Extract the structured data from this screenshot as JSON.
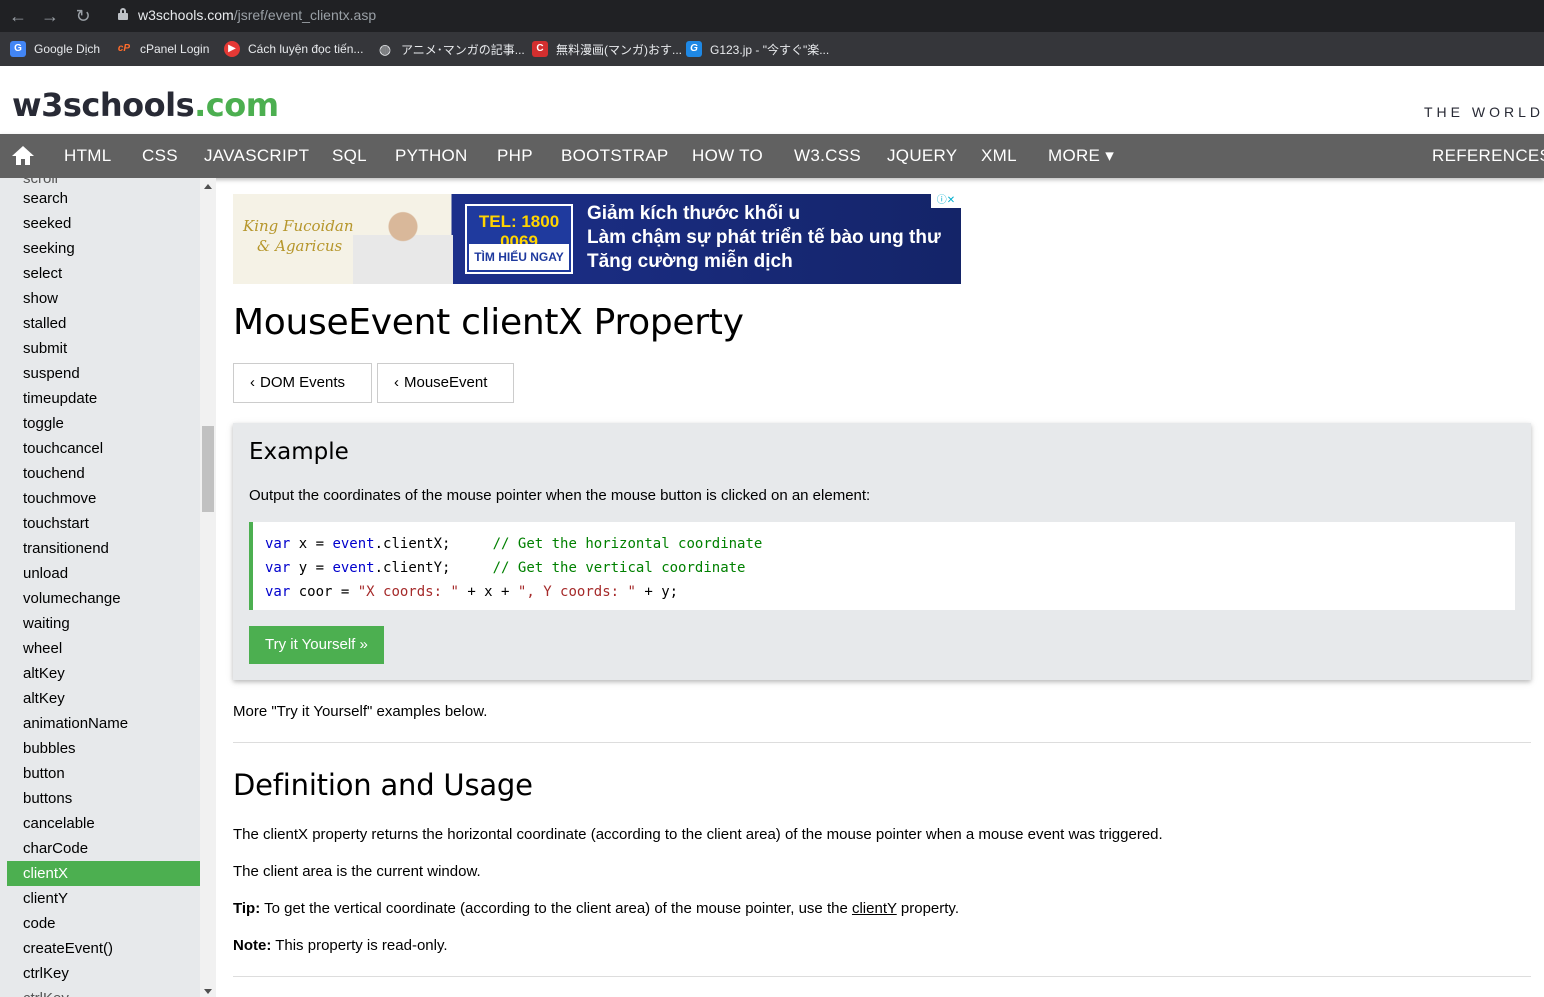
{
  "browser": {
    "url_host": "w3schools.com",
    "url_path": "/jsref/event_clientx.asp",
    "bookmarks": [
      {
        "label": "Google Dịch",
        "icon": "google-translate-icon",
        "color": "#4285f4"
      },
      {
        "label": "cPanel Login",
        "icon": "cpanel-icon",
        "color": "#ff6c2c"
      },
      {
        "label": "Cách luyện đọc tiến...",
        "icon": "youtube-icon",
        "color": "#e53935"
      },
      {
        "label": "アニメ･マンガの記事...",
        "icon": "globe-icon",
        "color": "#9aa0a6"
      },
      {
        "label": "無料漫画(マンガ)おす...",
        "icon": "c-logo-icon",
        "color": "#d32f2f"
      },
      {
        "label": "G123.jp - \"今すぐ\"楽...",
        "icon": "g123-icon",
        "color": "#1e88e5"
      }
    ]
  },
  "header": {
    "logo_main": "w3schools",
    "logo_tld": ".com",
    "tagline": "THE WORLD"
  },
  "topnav": {
    "items": [
      "HTML",
      "CSS",
      "JAVASCRIPT",
      "SQL",
      "PYTHON",
      "PHP",
      "BOOTSTRAP",
      "HOW TO",
      "W3.CSS",
      "JQUERY",
      "XML",
      "MORE ▾"
    ],
    "right": "REFERENCES ▾"
  },
  "sidebar": {
    "items": [
      "search",
      "seeked",
      "seeking",
      "select",
      "show",
      "stalled",
      "submit",
      "suspend",
      "timeupdate",
      "toggle",
      "touchcancel",
      "touchend",
      "touchmove",
      "touchstart",
      "transitionend",
      "unload",
      "volumechange",
      "waiting",
      "wheel",
      "altKey",
      "altKey",
      "animationName",
      "bubbles",
      "button",
      "buttons",
      "cancelable",
      "charCode",
      "clientX",
      "clientY",
      "code",
      "createEvent()",
      "ctrlKey"
    ],
    "active": "clientX"
  },
  "ad": {
    "brand_line1": "King Fucoidan",
    "brand_line2": "& Agaricus",
    "tel": "TEL: 1800 0069",
    "button": "TÌM HIỂU NGAY",
    "line1": "Giảm kích thước khối u",
    "line2": "Làm chậm sự phát triển tế bào ung thư",
    "line3": "Tăng cường miễn dịch",
    "choice": "ⓘ✕"
  },
  "page": {
    "title": "MouseEvent clientX Property",
    "btn_dom_events": "DOM Events",
    "btn_mouseevent": "MouseEvent",
    "example_heading": "Example",
    "example_desc": "Output the coordinates of the mouse pointer when the mouse button is clicked on an element:",
    "try_button": "Try it Yourself »",
    "more_examples": "More \"Try it Yourself\" examples below.",
    "def_heading": "Definition and Usage",
    "def_p1": "The clientX property returns the horizontal coordinate (according to the client area) of the mouse pointer when a mouse event was triggered.",
    "def_p2": "The client area is the current window.",
    "tip_label": "Tip:",
    "tip_text_before": " To get the vertical coordinate (according to the client area) of the mouse pointer, use the ",
    "tip_link": "clientY",
    "tip_text_after": " property.",
    "note_label": "Note:",
    "note_text": " This property is read-only."
  }
}
